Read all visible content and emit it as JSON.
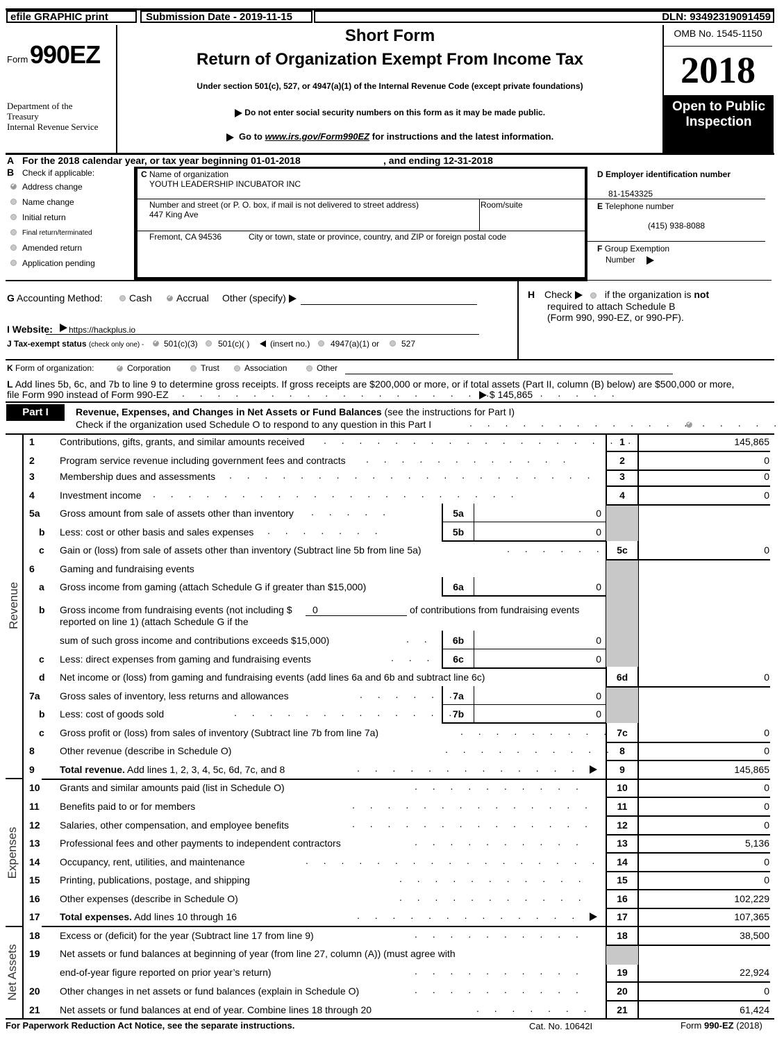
{
  "header": {
    "efile_label": "efile GRAPHIC print",
    "submission_date": "Submission Date - 2019-11-15",
    "dln": "DLN: 93492319091459",
    "form_prefix": "Form",
    "form_number": "990EZ",
    "department": "Department of the Treasury",
    "department_line1": "Department of the",
    "department_line2": "Treasury",
    "irs": "Internal Revenue Service",
    "title_short": "Short Form",
    "title_main": "Return of Organization Exempt From Income Tax",
    "subtitle": "Under section 501(c), 527, or 4947(a)(1) of the Internal Revenue Code (except private foundations)",
    "notice_ssn": "Do not enter social security numbers on this form as it may be made public.",
    "goto_prefix": "Go to",
    "goto_link": "www.irs.gov/Form990EZ",
    "goto_suffix": "for instructions and the latest information.",
    "omb": "OMB No. 1545-1150",
    "year": "2018",
    "open_public_line1": "Open to Public",
    "open_public_line2": "Inspection"
  },
  "section_a": {
    "letter": "A",
    "text": "For the 2018 calendar year, or tax year beginning 01-01-2018",
    "ending": ", and ending 12-31-2018"
  },
  "section_b": {
    "letter": "B",
    "label": "Check if applicable:",
    "items": [
      {
        "label": "Address change",
        "checked": true
      },
      {
        "label": "Name change",
        "checked": false
      },
      {
        "label": "Initial return",
        "checked": false
      },
      {
        "label": "Final return/terminated",
        "checked": false
      },
      {
        "label": "Amended return",
        "checked": false
      },
      {
        "label": "Application pending",
        "checked": false
      }
    ]
  },
  "section_c": {
    "letter": "C",
    "name_label": "Name of organization",
    "name": "YOUTH LEADERSHIP INCUBATOR INC",
    "street_label": "Number and street (or P. O. box, if mail is not delivered to street address)",
    "street": "447 King Ave",
    "room_label": "Room/suite",
    "city": "Fremont, CA   94536",
    "city_label": "City or town, state or province, country, and ZIP or foreign postal code"
  },
  "section_d": {
    "label": "D Employer identification number",
    "ein": "81-1543325"
  },
  "section_e": {
    "letter": "E",
    "label": "Telephone number",
    "phone": "(415) 938-8088"
  },
  "section_f": {
    "letter": "F",
    "label_line1": "Group Exemption",
    "label_line2": "Number"
  },
  "section_g": {
    "letter": "G",
    "label": "Accounting Method:",
    "options": [
      {
        "label": "Cash",
        "checked": false
      },
      {
        "label": "Accrual",
        "checked": true
      }
    ],
    "other_label": "Other (specify)"
  },
  "section_h": {
    "letter": "H",
    "check_label": "Check",
    "text1": "if the organization is",
    "text1_bold": "not",
    "text2": "required to attach Schedule B",
    "text3": "(Form 990, 990-EZ, or 990-PF)."
  },
  "section_i": {
    "label": "I Website:",
    "website": "https://hackplus.io"
  },
  "section_j": {
    "label": "J Tax-exempt status",
    "note": "(check only one) -",
    "options": [
      {
        "label": "501(c)(3)",
        "checked": true
      },
      {
        "label": "501(c)(   )",
        "checked": false
      },
      {
        "label": "(insert no.)",
        "checked": null
      },
      {
        "label": "4947(a)(1) or",
        "checked": false
      },
      {
        "label": "527",
        "checked": false
      }
    ]
  },
  "section_k": {
    "letter": "K",
    "label": "Form of organization:",
    "options": [
      {
        "label": "Corporation",
        "checked": true
      },
      {
        "label": "Trust",
        "checked": false
      },
      {
        "label": "Association",
        "checked": false
      },
      {
        "label": "Other",
        "checked": false
      }
    ]
  },
  "section_l": {
    "letter": "L",
    "line1": "Add lines 5b, 6c, and 7b to line 9 to determine gross receipts. If gross receipts are $200,000 or more, or if total assets (Part II, column (B) below) are $500,000 or more,",
    "line2": "file Form 990 instead of Form 990-EZ",
    "amount": "$ 145,865"
  },
  "part1": {
    "badge": "Part I",
    "title": "Revenue, Expenses, and Changes in Net Assets or Fund Balances",
    "title_note": "(see the instructions for Part I)",
    "schedule_o_text": "Check if the organization used Schedule O to respond to any question in this Part I",
    "schedule_o_checked": true,
    "side_labels": {
      "revenue": "Revenue",
      "expenses": "Expenses",
      "net_assets": "Net Assets"
    },
    "lines": {
      "l1": {
        "num": "1",
        "text": "Contributions, gifts, grants, and similar amounts received",
        "box": "1",
        "value": "145,865"
      },
      "l2": {
        "num": "2",
        "text": "Program service revenue including government fees and contracts",
        "box": "2",
        "value": "0"
      },
      "l3": {
        "num": "3",
        "text": "Membership dues and assessments",
        "box": "3",
        "value": "0"
      },
      "l4": {
        "num": "4",
        "text": "Investment income",
        "box": "4",
        "value": "0"
      },
      "l5a": {
        "num": "5a",
        "text": "Gross amount from sale of assets other than inventory",
        "box": "5a",
        "value": "0"
      },
      "l5b": {
        "num": "b",
        "text": "Less: cost or other basis and sales expenses",
        "box": "5b",
        "value": "0"
      },
      "l5c": {
        "num": "c",
        "text": "Gain or (loss) from sale of assets other than inventory (Subtract line 5b from line 5a)",
        "box": "5c",
        "value": "0"
      },
      "l6": {
        "num": "6",
        "text": "Gaming and fundraising events"
      },
      "l6a": {
        "num": "a",
        "text": "Gross income from gaming (attach Schedule G if greater than $15,000)",
        "box": "6a",
        "value": "0"
      },
      "l6b": {
        "num": "b",
        "text_a": "Gross income from fundraising events (not including $",
        "excluded_amount": "0",
        "text_b": "of contributions from fundraising events",
        "text_c": "reported on line 1) (attach Schedule G if the",
        "text_d": "sum of such gross income and contributions exceeds $15,000)",
        "box": "6b",
        "value": "0"
      },
      "l6c": {
        "num": "c",
        "text": "Less: direct expenses from gaming and fundraising events",
        "box": "6c",
        "value": "0"
      },
      "l6d": {
        "num": "d",
        "text": "Net income or (loss) from gaming and fundraising events (add lines 6a and 6b and subtract line 6c)",
        "box": "6d",
        "value": "0"
      },
      "l7a": {
        "num": "7a",
        "text": "Gross sales of inventory, less returns and allowances",
        "box": "7a",
        "value": "0"
      },
      "l7b": {
        "num": "b",
        "text": "Less: cost of goods sold",
        "box": "7b",
        "value": "0"
      },
      "l7c": {
        "num": "c",
        "text": "Gross profit or (loss) from sales of inventory (Subtract line 7b from line 7a)",
        "box": "7c",
        "value": "0"
      },
      "l8": {
        "num": "8",
        "text": "Other revenue (describe in Schedule O)",
        "box": "8",
        "value": "0"
      },
      "l9": {
        "num": "9",
        "text_bold": "Total revenue.",
        "text": "Add lines 1, 2, 3, 4, 5c, 6d, 7c, and 8",
        "box": "9",
        "value": "145,865"
      },
      "l10": {
        "num": "10",
        "text": "Grants and similar amounts paid (list in Schedule O)",
        "box": "10",
        "value": "0"
      },
      "l11": {
        "num": "11",
        "text": "Benefits paid to or for members",
        "box": "11",
        "value": "0"
      },
      "l12": {
        "num": "12",
        "text": "Salaries, other compensation, and employee benefits",
        "box": "12",
        "value": "0"
      },
      "l13": {
        "num": "13",
        "text": "Professional fees and other payments to independent contractors",
        "box": "13",
        "value": "5,136"
      },
      "l14": {
        "num": "14",
        "text": "Occupancy, rent, utilities, and maintenance",
        "box": "14",
        "value": "0"
      },
      "l15": {
        "num": "15",
        "text": "Printing, publications, postage, and shipping",
        "box": "15",
        "value": "0"
      },
      "l16": {
        "num": "16",
        "text": "Other expenses (describe in Schedule O)",
        "box": "16",
        "value": "102,229"
      },
      "l17": {
        "num": "17",
        "text_bold": "Total expenses.",
        "text": "Add lines 10 through 16",
        "box": "17",
        "value": "107,365"
      },
      "l18": {
        "num": "18",
        "text": "Excess or (deficit) for the year (Subtract line 17 from line 9)",
        "box": "18",
        "value": "38,500"
      },
      "l19": {
        "num": "19",
        "text_a": "Net assets or fund balances at beginning of year (from line 27, column (A)) (must agree with",
        "text_b": "end-of-year figure reported on prior year’s return)",
        "box": "19",
        "value": "22,924"
      },
      "l20": {
        "num": "20",
        "text": "Other changes in net assets or fund balances (explain in Schedule O)",
        "box": "20",
        "value": "0"
      },
      "l21": {
        "num": "21",
        "text": "Net assets or fund balances at end of year. Combine lines 18 through 20",
        "box": "21",
        "value": "61,424"
      }
    }
  },
  "footer": {
    "paperwork": "For Paperwork Reduction Act Notice, see the separate instructions.",
    "cat_no": "Cat. No. 10642I",
    "form_prefix": "Form",
    "form_bold": "990-EZ",
    "form_year": "(2018)"
  }
}
